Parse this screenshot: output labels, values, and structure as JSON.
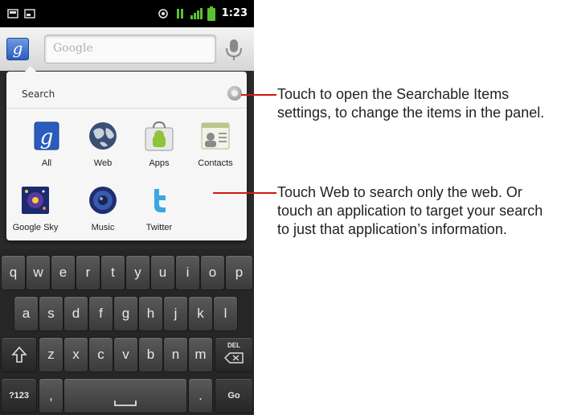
{
  "status_bar": {
    "time": "1:23",
    "icons": [
      "sd-card-icon",
      "sim-icon",
      "gps-icon",
      "data-icon",
      "signal-icon",
      "battery-icon"
    ]
  },
  "search_bar": {
    "source_icon": "google-g-icon",
    "placeholder": "Google",
    "mic_icon": "microphone-icon"
  },
  "panel": {
    "title": "Search",
    "settings_icon": "settings-icon",
    "apps": [
      {
        "label": "All",
        "icon": "google-g-icon"
      },
      {
        "label": "Web",
        "icon": "globe-icon"
      },
      {
        "label": "Apps",
        "icon": "market-icon"
      },
      {
        "label": "Contacts",
        "icon": "contacts-icon"
      },
      {
        "label": "Google Sky",
        "icon": "sky-icon"
      },
      {
        "label": "Music",
        "icon": "speaker-icon"
      },
      {
        "label": "Twitter",
        "icon": "twitter-icon"
      }
    ]
  },
  "keyboard": {
    "row1": [
      "q",
      "w",
      "e",
      "r",
      "t",
      "y",
      "u",
      "i",
      "o",
      "p"
    ],
    "row2": [
      "a",
      "s",
      "d",
      "f",
      "g",
      "h",
      "j",
      "k",
      "l"
    ],
    "row3": [
      "z",
      "x",
      "c",
      "v",
      "b",
      "n",
      "m"
    ],
    "del_label": "DEL",
    "symbols_label": "?123",
    "comma_label": ",",
    "period_label": ".",
    "go_label": "Go"
  },
  "callouts": [
    {
      "text": "Touch to open the Searchable Items settings, to change the items in the panel."
    },
    {
      "text": "Touch Web to search only the web. Or touch an application to target your search to just that application’s information."
    }
  ],
  "colors": {
    "callout_line": "#d01818",
    "google_blue": "#2a5cbf"
  }
}
